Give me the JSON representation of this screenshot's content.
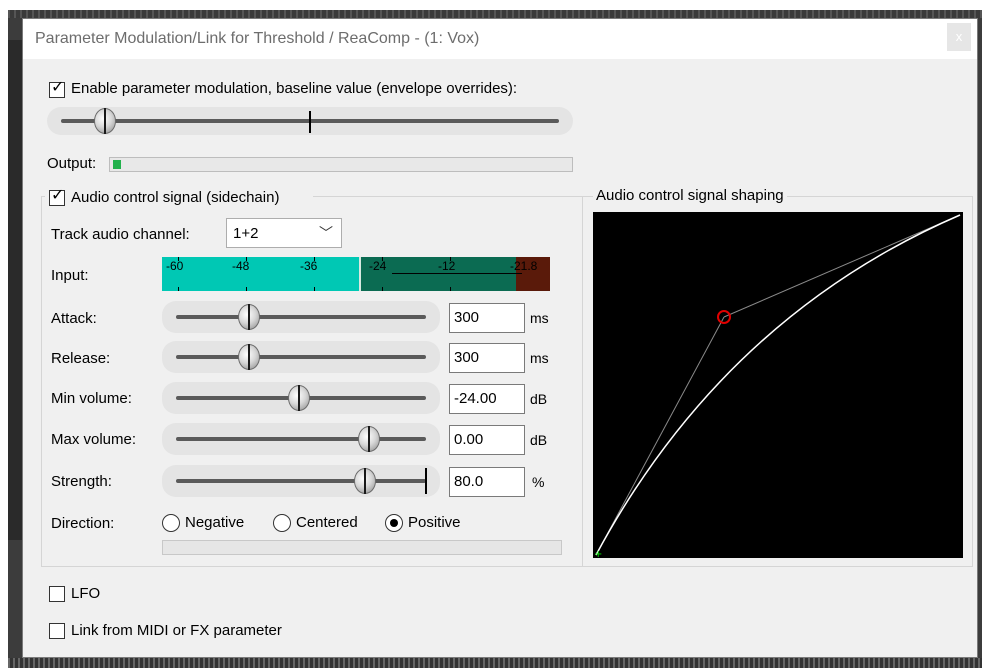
{
  "window": {
    "title": "Parameter Modulation/Link for Threshold / ReaComp - (1: Vox)",
    "close_glyph": "x"
  },
  "baseline": {
    "enable_label": "Enable parameter modulation, baseline value (envelope overrides):",
    "enabled": true,
    "value_fraction": 0.07
  },
  "output": {
    "label": "Output:",
    "level_fraction": 0.016,
    "color": "#22b14c"
  },
  "sidechain": {
    "label": "Audio control signal (sidechain)",
    "enabled": true,
    "track_channel_label": "Track audio channel:",
    "track_channel_value": "1+2",
    "input_label": "Input:",
    "input_meter_labels": [
      "-60",
      "-48",
      "-36",
      "-24",
      "-12",
      "-21.8"
    ],
    "input_meter_colors": [
      "#00c8b4",
      "#0b6b52",
      "#5a1a0a"
    ],
    "params": [
      {
        "label": "Attack:",
        "value": "300",
        "unit": "ms",
        "fraction": 0.27
      },
      {
        "label": "Release:",
        "value": "300",
        "unit": "ms",
        "fraction": 0.27
      },
      {
        "label": "Min volume:",
        "value": "-24.00",
        "unit": "dB",
        "fraction": 0.49
      },
      {
        "label": "Max volume:",
        "value": "0.00",
        "unit": "dB",
        "fraction": 0.8
      },
      {
        "label": "Strength:",
        "value": "80.0",
        "unit": "%",
        "fraction": 0.78
      }
    ],
    "direction_label": "Direction:",
    "direction_options": [
      "Negative",
      "Centered",
      "Positive"
    ],
    "direction_selected": "Positive"
  },
  "shaping": {
    "label": "Audio control signal shaping",
    "background": "#000000",
    "curve_color": "#ffffff",
    "handle_color": "#e00000",
    "origin_color": "#00e000"
  },
  "lfo": {
    "label": "LFO",
    "enabled": false
  },
  "link": {
    "label": "Link from MIDI or FX parameter",
    "enabled": false
  }
}
